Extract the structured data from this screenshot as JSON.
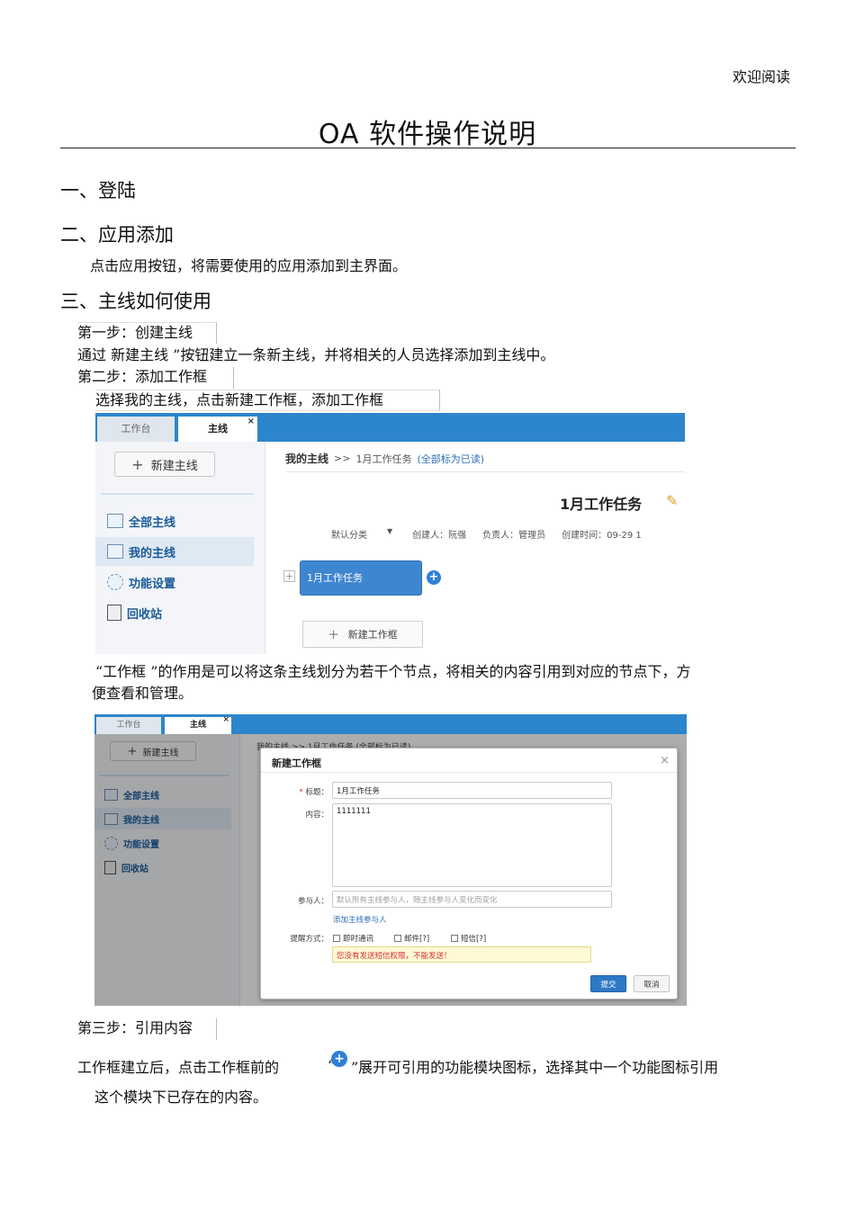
{
  "header_note": "欢迎阅读",
  "title": "OA 软件操作说明",
  "sections": {
    "s1": "一、登陆",
    "s2": "二、应用添加",
    "s2_text": "点击应用按钮，将需要使用的应用添加到主界面。",
    "s3": "三、主线如何使用",
    "step1": "第一步：创建主线",
    "step1_text": "通过 新建主线 ”按钮建立一条新主线，并将相关的人员选择添加到主线中。",
    "step2": "第二步：添加工作框",
    "step2_text": "选择我的主线，点击新建工作框，添加工作框",
    "frame_text_line1": "“工作框 ”的作用是可以将这条主线划分为若干个节点，将相关的内容引用到对应的节点下，方",
    "frame_text_line2": "便查看和管理。",
    "step3": "第三步：引用内容",
    "step3_text_a": "工作框建立后，点击工作框前的",
    "step3_text_b": "“",
    "step3_text_c": "”展开可引用的功能模块图标，选择其中一个功能图标引用",
    "step3_text_line2": "这个模块下已存在的内容。"
  },
  "app": {
    "tabs": [
      "工作台",
      "主线"
    ],
    "tab_close": "×",
    "new_mainline_button": "新建主线",
    "nav": [
      "全部主线",
      "我的主线",
      "功能设置",
      "回收站"
    ],
    "breadcrumb": {
      "root": "我的主线",
      "sep": ">>",
      "current": "1月工作任务",
      "action": "(全部标为已读)"
    },
    "mainline_title": "1月工作任务",
    "meta": {
      "category": "默认分类",
      "creator": "创建人：阮强",
      "owner": "负责人：管理员",
      "created": "创建时间：09-29 1"
    },
    "node_label": "1月工作任务",
    "expand_symbol": "+",
    "new_frame_button": "新建工作框"
  },
  "dialog": {
    "title": "新建工作框",
    "close": "×",
    "title_label": "标题：",
    "title_value": "1月工作任务",
    "content_label": "内容：",
    "content_value": "1111111",
    "participants_label": "参与人：",
    "participants_placeholder": "默认所有主线参与人，随主线参与人变化而变化",
    "add_participants_link": "添加主线参与人",
    "remind_label": "提醒方式：",
    "remind_options": [
      "即时通讯",
      "邮件[?]",
      "短信[?]"
    ],
    "warning": "您没有发送短信权限，不能发送！",
    "submit": "提交",
    "cancel": "取消",
    "behind_breadcrumb": "我的主线 >> 1月工作任务 (全部标为已读)"
  },
  "colors": {
    "topbar": "#2d85cc",
    "nav_text": "#1a5a9a",
    "node": "#3f86d1",
    "link": "#2d6fb7",
    "warning_text": "#d03030"
  }
}
